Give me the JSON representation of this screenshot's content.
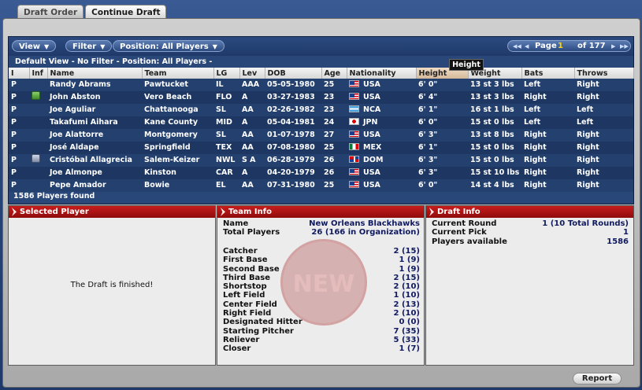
{
  "tabs": [
    "Draft Order",
    "Continue Draft"
  ],
  "toolbar": {
    "view": "View",
    "filter": "Filter",
    "position": "Position: All Players",
    "page_label": "Page",
    "page_current": "1",
    "page_total": "of 177"
  },
  "view_line": "Default View - No Filter - Position: All Players -",
  "columns": [
    "I",
    "Inf",
    "Name",
    "Team",
    "LG",
    "Lev",
    "DOB",
    "Age",
    "Nationality",
    "Height",
    "Weight",
    "Bats",
    "Throws"
  ],
  "sorted_column": "Height",
  "tooltip": "Height",
  "players": [
    {
      "pos": "P",
      "inf": "",
      "name": "Randy Abrams",
      "team": "Pawtucket",
      "lg": "IL",
      "lev": "AAA",
      "dob": "05-05-1980",
      "age": "25",
      "flag": "usa",
      "nat": "USA",
      "height": "6' 0\"",
      "weight": "13 st 3 lbs",
      "bats": "Left",
      "throws": "Right"
    },
    {
      "pos": "P",
      "inf": "green",
      "name": "John Abston",
      "team": "Vero Beach",
      "lg": "FLO",
      "lev": "A",
      "dob": "03-27-1983",
      "age": "23",
      "flag": "usa",
      "nat": "USA",
      "height": "6' 4\"",
      "weight": "13 st 3 lbs",
      "bats": "Right",
      "throws": "Right"
    },
    {
      "pos": "P",
      "inf": "",
      "name": "Joe Aguliar",
      "team": "Chattanooga",
      "lg": "SL",
      "lev": "AA",
      "dob": "02-26-1982",
      "age": "23",
      "flag": "nca",
      "nat": "NCA",
      "height": "6' 1\"",
      "weight": "16 st 1 lbs",
      "bats": "Left",
      "throws": "Left"
    },
    {
      "pos": "P",
      "inf": "",
      "name": "Takafumi Aihara",
      "team": "Kane County",
      "lg": "MID",
      "lev": "A",
      "dob": "05-04-1981",
      "age": "24",
      "flag": "jpn",
      "nat": "JPN",
      "height": "6' 0\"",
      "weight": "15 st 0 lbs",
      "bats": "Left",
      "throws": "Left"
    },
    {
      "pos": "P",
      "inf": "",
      "name": "Joe Alattorre",
      "team": "Montgomery",
      "lg": "SL",
      "lev": "AA",
      "dob": "01-07-1978",
      "age": "27",
      "flag": "usa",
      "nat": "USA",
      "height": "6' 3\"",
      "weight": "13 st 8 lbs",
      "bats": "Right",
      "throws": "Right"
    },
    {
      "pos": "P",
      "inf": "",
      "name": "José Aldape",
      "team": "Springfield",
      "lg": "TEX",
      "lev": "AA",
      "dob": "07-08-1980",
      "age": "25",
      "flag": "mex",
      "nat": "MEX",
      "height": "6' 1\"",
      "weight": "15 st 0 lbs",
      "bats": "Right",
      "throws": "Right"
    },
    {
      "pos": "P",
      "inf": "gray",
      "name": "Cristóbal Allagrecia",
      "team": "Salem-Keizer",
      "lg": "NWL",
      "lev": "S A",
      "dob": "06-28-1979",
      "age": "26",
      "flag": "dom",
      "nat": "DOM",
      "height": "6' 3\"",
      "weight": "15 st 0 lbs",
      "bats": "Right",
      "throws": "Right"
    },
    {
      "pos": "P",
      "inf": "",
      "name": "Joe Almonpe",
      "team": "Kinston",
      "lg": "CAR",
      "lev": "A",
      "dob": "04-20-1979",
      "age": "26",
      "flag": "usa",
      "nat": "USA",
      "height": "6' 3\"",
      "weight": "15 st 10 lbs",
      "bats": "Right",
      "throws": "Right"
    },
    {
      "pos": "P",
      "inf": "",
      "name": "Pepe Amador",
      "team": "Bowie",
      "lg": "EL",
      "lev": "AA",
      "dob": "07-31-1980",
      "age": "25",
      "flag": "usa",
      "nat": "USA",
      "height": "6' 0\"",
      "weight": "14 st 4 lbs",
      "bats": "Right",
      "throws": "Right"
    }
  ],
  "players_found": "1586 Players found",
  "selected_player": {
    "title": "Selected Player",
    "message": "The Draft is finished!"
  },
  "team_info": {
    "title": "Team Info",
    "name_label": "Name",
    "name_value": "New Orleans Blackhawks",
    "total_label": "Total Players",
    "total_value": "26 (166 in Organization)",
    "positions": [
      {
        "label": "Catcher",
        "value": "2 (15)"
      },
      {
        "label": "First Base",
        "value": "1 (9)"
      },
      {
        "label": "Second Base",
        "value": "1 (9)"
      },
      {
        "label": "Third Base",
        "value": "2 (15)"
      },
      {
        "label": "Shortstop",
        "value": "2 (10)"
      },
      {
        "label": "Left Field",
        "value": "1 (10)"
      },
      {
        "label": "Center Field",
        "value": "2 (13)"
      },
      {
        "label": "Right Field",
        "value": "2 (10)"
      },
      {
        "label": "Designated Hitter",
        "value": "0 (0)"
      },
      {
        "label": "Starting Pitcher",
        "value": "7 (35)"
      },
      {
        "label": "Reliever",
        "value": "5 (33)"
      },
      {
        "label": "Closer",
        "value": "1 (7)"
      }
    ],
    "stamp": "NEW"
  },
  "draft_info": {
    "title": "Draft Info",
    "rows": [
      {
        "label": "Current Round",
        "value": "1 (10 Total Rounds)"
      },
      {
        "label": "Current Pick",
        "value": "1"
      },
      {
        "label": "Players available",
        "value": "1586"
      }
    ]
  },
  "report_label": "Report"
}
